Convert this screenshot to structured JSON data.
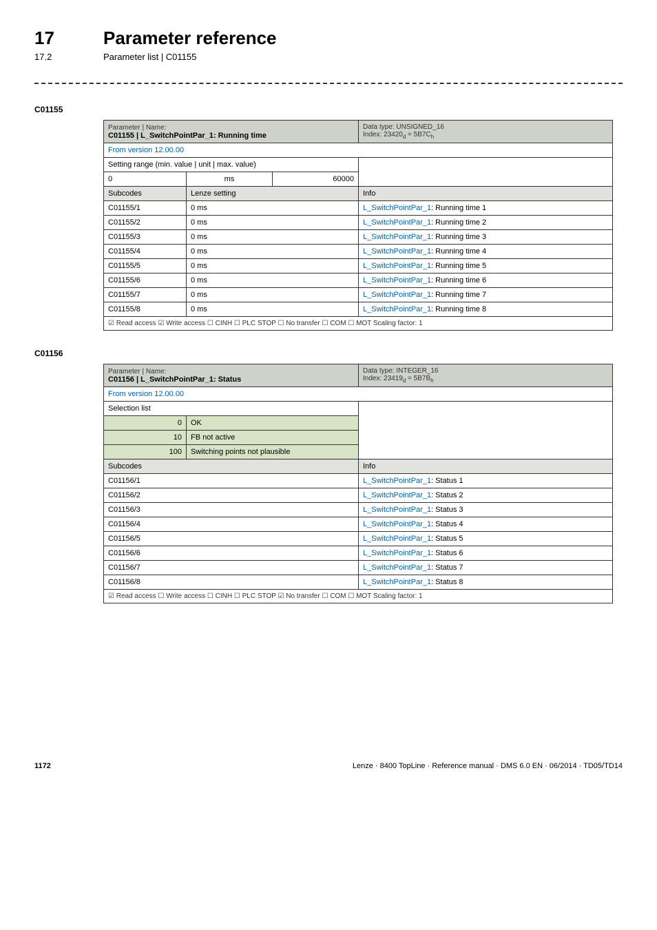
{
  "header": {
    "chapter_num": "17",
    "chapter_title": "Parameter reference",
    "section_num": "17.2",
    "section_title": "Parameter list | C01155"
  },
  "table1": {
    "code": "C01155",
    "pn_label": "Parameter | Name:",
    "pn_value": "C01155 | L_SwitchPointPar_1: Running time",
    "dt_line1": "Data type: UNSIGNED_16",
    "dt_line2_a": "Index: 23420",
    "dt_line2_b": " = 5B7C",
    "version": "From version 12.00.00",
    "setting_label": "Setting range (min. value | unit | max. value)",
    "min": "0",
    "unit": "ms",
    "max": "60000",
    "subcodes_h": "Subcodes",
    "lenze_h": "Lenze setting",
    "info_h": "Info",
    "rows": [
      {
        "sub": "C01155/1",
        "val": "0 ms",
        "link": "L_SwitchPointPar_1",
        "txt": ": Running time 1"
      },
      {
        "sub": "C01155/2",
        "val": "0 ms",
        "link": "L_SwitchPointPar_1",
        "txt": ": Running time 2"
      },
      {
        "sub": "C01155/3",
        "val": "0 ms",
        "link": "L_SwitchPointPar_1",
        "txt": ": Running time 3"
      },
      {
        "sub": "C01155/4",
        "val": "0 ms",
        "link": "L_SwitchPointPar_1",
        "txt": ": Running time 4"
      },
      {
        "sub": "C01155/5",
        "val": "0 ms",
        "link": "L_SwitchPointPar_1",
        "txt": ": Running time 5"
      },
      {
        "sub": "C01155/6",
        "val": "0 ms",
        "link": "L_SwitchPointPar_1",
        "txt": ": Running time 6"
      },
      {
        "sub": "C01155/7",
        "val": "0 ms",
        "link": "L_SwitchPointPar_1",
        "txt": ": Running time 7"
      },
      {
        "sub": "C01155/8",
        "val": "0 ms",
        "link": "L_SwitchPointPar_1",
        "txt": ": Running time 8"
      }
    ],
    "access": "☑ Read access   ☑ Write access   ☐ CINH   ☐ PLC STOP   ☐ No transfer   ☐ COM   ☐ MOT    Scaling factor: 1"
  },
  "table2": {
    "code": "C01156",
    "pn_label": "Parameter | Name:",
    "pn_value": "C01156 | L_SwitchPointPar_1: Status",
    "dt_line1": "Data type: INTEGER_16",
    "dt_line2_a": "Index: 23419",
    "dt_line2_b": " = 5B7B",
    "version": "From version 12.00.00",
    "selection_h": "Selection list",
    "sel": [
      {
        "n": "0",
        "t": "OK"
      },
      {
        "n": "10",
        "t": "FB not active"
      },
      {
        "n": "100",
        "t": "Switching points not plausible"
      }
    ],
    "subcodes_h": "Subcodes",
    "info_h": "Info",
    "rows": [
      {
        "sub": "C01156/1",
        "link": "L_SwitchPointPar_1",
        "txt": ": Status 1"
      },
      {
        "sub": "C01156/2",
        "link": "L_SwitchPointPar_1",
        "txt": ": Status 2"
      },
      {
        "sub": "C01156/3",
        "link": "L_SwitchPointPar_1",
        "txt": ": Status 3"
      },
      {
        "sub": "C01156/4",
        "link": "L_SwitchPointPar_1",
        "txt": ": Status 4"
      },
      {
        "sub": "C01156/5",
        "link": "L_SwitchPointPar_1",
        "txt": ": Status 5"
      },
      {
        "sub": "C01156/6",
        "link": "L_SwitchPointPar_1",
        "txt": ": Status 6"
      },
      {
        "sub": "C01156/7",
        "link": "L_SwitchPointPar_1",
        "txt": ": Status 7"
      },
      {
        "sub": "C01156/8",
        "link": "L_SwitchPointPar_1",
        "txt": ": Status 8"
      }
    ],
    "access": "☑ Read access   ☐ Write access   ☐ CINH   ☐ PLC STOP   ☑ No transfer   ☐ COM   ☐ MOT    Scaling factor: 1"
  },
  "footer": {
    "page": "1172",
    "right": "Lenze · 8400 TopLine · Reference manual · DMS 6.0 EN · 06/2014 · TD05/TD14"
  }
}
